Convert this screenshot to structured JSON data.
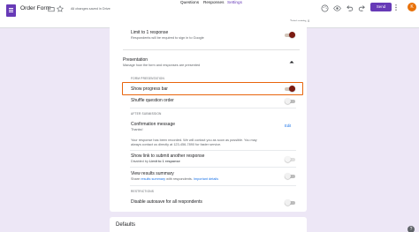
{
  "header": {
    "doc_title": "Order Form",
    "saved_status": "All changes saved in Drive",
    "send_label": "Send",
    "avatar_letter": "K",
    "icons": {
      "app": "forms-icon",
      "folder": "folder-icon",
      "star": "star-icon",
      "palette": "palette-icon",
      "preview": "eye-icon",
      "undo": "undo-icon",
      "redo": "redo-icon",
      "link": "link-icon",
      "more": "more-vert-icon"
    }
  },
  "tabs": [
    {
      "label": "Questions",
      "active": false
    },
    {
      "label": "Responses",
      "active": false
    },
    {
      "label": "Settings",
      "active": true
    }
  ],
  "total_points": "Total points: 0",
  "settings": {
    "limit_response": {
      "title": "Limit to 1 response",
      "subtitle": "Respondents will be required to sign in to Google",
      "enabled": true
    },
    "presentation": {
      "title": "Presentation",
      "subtitle": "Manage how the form and responses are presented",
      "form_presentation_label": "FORM PRESENTATION",
      "show_progress_bar": {
        "title": "Show progress bar",
        "enabled": true
      },
      "shuffle_question_order": {
        "title": "Shuffle question order",
        "enabled": false
      },
      "after_submission_label": "AFTER SUBMISSION",
      "confirmation_message": {
        "title": "Confirmation message",
        "value": "Thanks!",
        "edit_label": "Edit"
      },
      "notice_line1": "Your response has been recorded. We will contact you as soon as possible. You may",
      "notice_line2": "always contact us directly at 123-456-7890 for faster service.",
      "show_link_another": {
        "title": "Show link to submit another response",
        "subtitle_prefix": "Disabled by",
        "subtitle_bold": "Limit to 1 response",
        "enabled": false
      },
      "view_results_summary": {
        "title": "View results summary",
        "subtitle_prefix": "Share",
        "subtitle_link1": "results summary",
        "subtitle_middle": "with respondents.",
        "subtitle_link2": "Important details",
        "enabled": false
      },
      "restrictions_label": "RESTRICTIONS",
      "disable_autosave": {
        "title": "Disable autosave for all respondents",
        "enabled": false
      }
    },
    "defaults_title": "Defaults"
  }
}
